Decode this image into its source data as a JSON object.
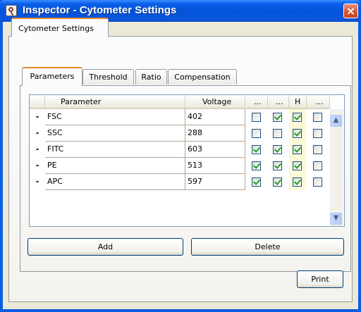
{
  "window": {
    "title": "Inspector - Cytometer Settings",
    "close_glyph": "×"
  },
  "outer_tabs": [
    {
      "label": "Cytometer Settings"
    }
  ],
  "inner_tabs": [
    {
      "label": "Parameters"
    },
    {
      "label": "Threshold"
    },
    {
      "label": "Ratio"
    },
    {
      "label": "Compensation"
    }
  ],
  "grid": {
    "columns": [
      {
        "label": "Parameter"
      },
      {
        "label": "Voltage"
      },
      {
        "label": "..."
      },
      {
        "label": "..."
      },
      {
        "label": "H"
      },
      {
        "label": "..."
      }
    ],
    "rows": [
      {
        "parameter": "FSC",
        "voltage": "402",
        "checks": [
          false,
          true,
          true,
          false
        ]
      },
      {
        "parameter": "SSC",
        "voltage": "288",
        "checks": [
          false,
          false,
          true,
          false
        ]
      },
      {
        "parameter": "FITC",
        "voltage": "603",
        "checks": [
          true,
          true,
          true,
          false
        ]
      },
      {
        "parameter": "PE",
        "voltage": "513",
        "checks": [
          true,
          true,
          true,
          false
        ]
      },
      {
        "parameter": "APC",
        "voltage": "597",
        "checks": [
          true,
          true,
          true,
          false
        ]
      }
    ]
  },
  "buttons": {
    "add": "Add",
    "delete": "Delete",
    "print": "Print"
  },
  "icons": {
    "title_icon": "inspector-magnifier-icon",
    "scroll_up": "▲",
    "scroll_down": "▼"
  },
  "colors": {
    "titlebar": "#0353d8",
    "tab_highlight": "#e68b2c",
    "checkmark": "#21a121",
    "h_column_highlight": "#fcf9d7"
  }
}
